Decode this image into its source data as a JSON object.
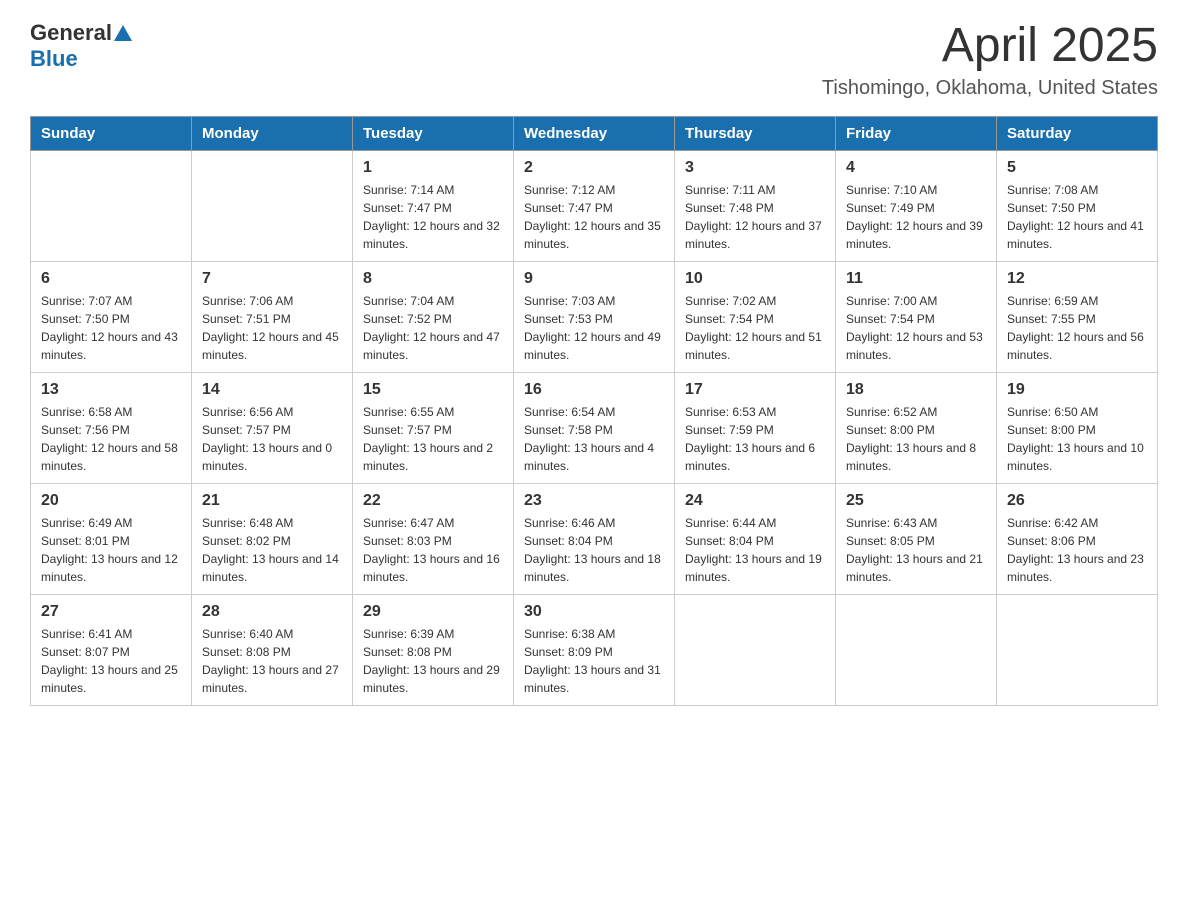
{
  "header": {
    "logo_general": "General",
    "logo_blue": "Blue",
    "month_year": "April 2025",
    "location": "Tishomingo, Oklahoma, United States"
  },
  "weekdays": [
    "Sunday",
    "Monday",
    "Tuesday",
    "Wednesday",
    "Thursday",
    "Friday",
    "Saturday"
  ],
  "weeks": [
    [
      {
        "day": "",
        "sunrise": "",
        "sunset": "",
        "daylight": ""
      },
      {
        "day": "",
        "sunrise": "",
        "sunset": "",
        "daylight": ""
      },
      {
        "day": "1",
        "sunrise": "Sunrise: 7:14 AM",
        "sunset": "Sunset: 7:47 PM",
        "daylight": "Daylight: 12 hours and 32 minutes."
      },
      {
        "day": "2",
        "sunrise": "Sunrise: 7:12 AM",
        "sunset": "Sunset: 7:47 PM",
        "daylight": "Daylight: 12 hours and 35 minutes."
      },
      {
        "day": "3",
        "sunrise": "Sunrise: 7:11 AM",
        "sunset": "Sunset: 7:48 PM",
        "daylight": "Daylight: 12 hours and 37 minutes."
      },
      {
        "day": "4",
        "sunrise": "Sunrise: 7:10 AM",
        "sunset": "Sunset: 7:49 PM",
        "daylight": "Daylight: 12 hours and 39 minutes."
      },
      {
        "day": "5",
        "sunrise": "Sunrise: 7:08 AM",
        "sunset": "Sunset: 7:50 PM",
        "daylight": "Daylight: 12 hours and 41 minutes."
      }
    ],
    [
      {
        "day": "6",
        "sunrise": "Sunrise: 7:07 AM",
        "sunset": "Sunset: 7:50 PM",
        "daylight": "Daylight: 12 hours and 43 minutes."
      },
      {
        "day": "7",
        "sunrise": "Sunrise: 7:06 AM",
        "sunset": "Sunset: 7:51 PM",
        "daylight": "Daylight: 12 hours and 45 minutes."
      },
      {
        "day": "8",
        "sunrise": "Sunrise: 7:04 AM",
        "sunset": "Sunset: 7:52 PM",
        "daylight": "Daylight: 12 hours and 47 minutes."
      },
      {
        "day": "9",
        "sunrise": "Sunrise: 7:03 AM",
        "sunset": "Sunset: 7:53 PM",
        "daylight": "Daylight: 12 hours and 49 minutes."
      },
      {
        "day": "10",
        "sunrise": "Sunrise: 7:02 AM",
        "sunset": "Sunset: 7:54 PM",
        "daylight": "Daylight: 12 hours and 51 minutes."
      },
      {
        "day": "11",
        "sunrise": "Sunrise: 7:00 AM",
        "sunset": "Sunset: 7:54 PM",
        "daylight": "Daylight: 12 hours and 53 minutes."
      },
      {
        "day": "12",
        "sunrise": "Sunrise: 6:59 AM",
        "sunset": "Sunset: 7:55 PM",
        "daylight": "Daylight: 12 hours and 56 minutes."
      }
    ],
    [
      {
        "day": "13",
        "sunrise": "Sunrise: 6:58 AM",
        "sunset": "Sunset: 7:56 PM",
        "daylight": "Daylight: 12 hours and 58 minutes."
      },
      {
        "day": "14",
        "sunrise": "Sunrise: 6:56 AM",
        "sunset": "Sunset: 7:57 PM",
        "daylight": "Daylight: 13 hours and 0 minutes."
      },
      {
        "day": "15",
        "sunrise": "Sunrise: 6:55 AM",
        "sunset": "Sunset: 7:57 PM",
        "daylight": "Daylight: 13 hours and 2 minutes."
      },
      {
        "day": "16",
        "sunrise": "Sunrise: 6:54 AM",
        "sunset": "Sunset: 7:58 PM",
        "daylight": "Daylight: 13 hours and 4 minutes."
      },
      {
        "day": "17",
        "sunrise": "Sunrise: 6:53 AM",
        "sunset": "Sunset: 7:59 PM",
        "daylight": "Daylight: 13 hours and 6 minutes."
      },
      {
        "day": "18",
        "sunrise": "Sunrise: 6:52 AM",
        "sunset": "Sunset: 8:00 PM",
        "daylight": "Daylight: 13 hours and 8 minutes."
      },
      {
        "day": "19",
        "sunrise": "Sunrise: 6:50 AM",
        "sunset": "Sunset: 8:00 PM",
        "daylight": "Daylight: 13 hours and 10 minutes."
      }
    ],
    [
      {
        "day": "20",
        "sunrise": "Sunrise: 6:49 AM",
        "sunset": "Sunset: 8:01 PM",
        "daylight": "Daylight: 13 hours and 12 minutes."
      },
      {
        "day": "21",
        "sunrise": "Sunrise: 6:48 AM",
        "sunset": "Sunset: 8:02 PM",
        "daylight": "Daylight: 13 hours and 14 minutes."
      },
      {
        "day": "22",
        "sunrise": "Sunrise: 6:47 AM",
        "sunset": "Sunset: 8:03 PM",
        "daylight": "Daylight: 13 hours and 16 minutes."
      },
      {
        "day": "23",
        "sunrise": "Sunrise: 6:46 AM",
        "sunset": "Sunset: 8:04 PM",
        "daylight": "Daylight: 13 hours and 18 minutes."
      },
      {
        "day": "24",
        "sunrise": "Sunrise: 6:44 AM",
        "sunset": "Sunset: 8:04 PM",
        "daylight": "Daylight: 13 hours and 19 minutes."
      },
      {
        "day": "25",
        "sunrise": "Sunrise: 6:43 AM",
        "sunset": "Sunset: 8:05 PM",
        "daylight": "Daylight: 13 hours and 21 minutes."
      },
      {
        "day": "26",
        "sunrise": "Sunrise: 6:42 AM",
        "sunset": "Sunset: 8:06 PM",
        "daylight": "Daylight: 13 hours and 23 minutes."
      }
    ],
    [
      {
        "day": "27",
        "sunrise": "Sunrise: 6:41 AM",
        "sunset": "Sunset: 8:07 PM",
        "daylight": "Daylight: 13 hours and 25 minutes."
      },
      {
        "day": "28",
        "sunrise": "Sunrise: 6:40 AM",
        "sunset": "Sunset: 8:08 PM",
        "daylight": "Daylight: 13 hours and 27 minutes."
      },
      {
        "day": "29",
        "sunrise": "Sunrise: 6:39 AM",
        "sunset": "Sunset: 8:08 PM",
        "daylight": "Daylight: 13 hours and 29 minutes."
      },
      {
        "day": "30",
        "sunrise": "Sunrise: 6:38 AM",
        "sunset": "Sunset: 8:09 PM",
        "daylight": "Daylight: 13 hours and 31 minutes."
      },
      {
        "day": "",
        "sunrise": "",
        "sunset": "",
        "daylight": ""
      },
      {
        "day": "",
        "sunrise": "",
        "sunset": "",
        "daylight": ""
      },
      {
        "day": "",
        "sunrise": "",
        "sunset": "",
        "daylight": ""
      }
    ]
  ]
}
